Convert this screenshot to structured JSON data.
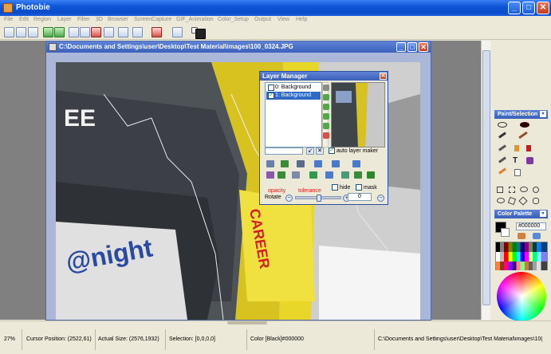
{
  "app": {
    "title": "Photobie"
  },
  "menu": [
    "File",
    "Edit",
    "Region",
    "Layer",
    "Filter",
    "3D",
    "Browser",
    "ScreenCapture",
    "GIF_Animation",
    "Color_Setup",
    "Output",
    "View",
    "Help"
  ],
  "document": {
    "path": "C:\\Documents and Settings\\user\\Desktop\\Test Material\\images\\100_0324.JPG"
  },
  "panels": {
    "paint_selection": "Paint/Selection",
    "color_palette": "Color Palette",
    "current_color": "#000000"
  },
  "layer_manager": {
    "title": "Layer Manager",
    "layers": [
      {
        "label": "0: Background",
        "checked": false,
        "selected": false
      },
      {
        "label": "1: Background",
        "checked": true,
        "selected": true
      }
    ],
    "auto_layer_maker": "auto layer maker",
    "opacity_label": "opacity",
    "tolerance_label": "tolerance",
    "hide_label": "hide",
    "mask_label": "mask",
    "rotate_label": "Rotate",
    "rotate_value": "0"
  },
  "status": {
    "zoom": "27%",
    "cursor": "Cursor Position:  (2522,61)",
    "actual_size": "Actual Size:  (2576,1932)",
    "selection": "Selection: [0,0,0,0]",
    "color": "Color [Black]#000000",
    "path": "C:\\Documents and Settings\\user\\Desktop\\Test Material\\images\\10("
  },
  "colors": {
    "titlebar": "#0a4cc9",
    "doc_title": "#3c61bc",
    "selection": "#316ac5"
  }
}
